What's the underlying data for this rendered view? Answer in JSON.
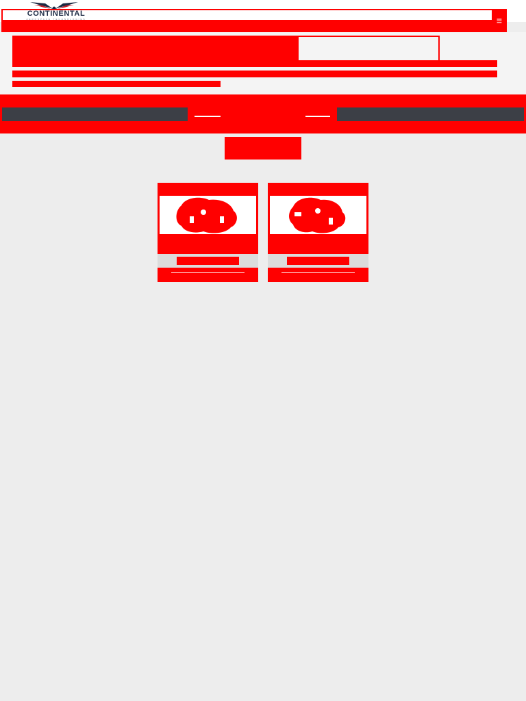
{
  "header": {
    "logo_text": "CONTINENTAL",
    "logo_sub": "AEROSPACE TECHNOLOGIES",
    "account_link": "",
    "menu_icon": "menu-icon"
  },
  "hero": {
    "title": "",
    "subtitle_1": "",
    "subtitle_2": "",
    "subtitle_3": ""
  },
  "tabs": [
    {
      "label": ""
    },
    {
      "label": ""
    },
    {
      "label": ""
    }
  ],
  "action": {
    "label": ""
  },
  "cards": [
    {
      "image_icon": "engine-icon",
      "caption": "",
      "link": ""
    },
    {
      "image_icon": "engine-icon",
      "caption": "",
      "link": ""
    }
  ],
  "colors": {
    "accent": "#ff0000",
    "tab_bar": "#3c3f46",
    "background": "#ededed",
    "logo": "#1c2a44"
  }
}
